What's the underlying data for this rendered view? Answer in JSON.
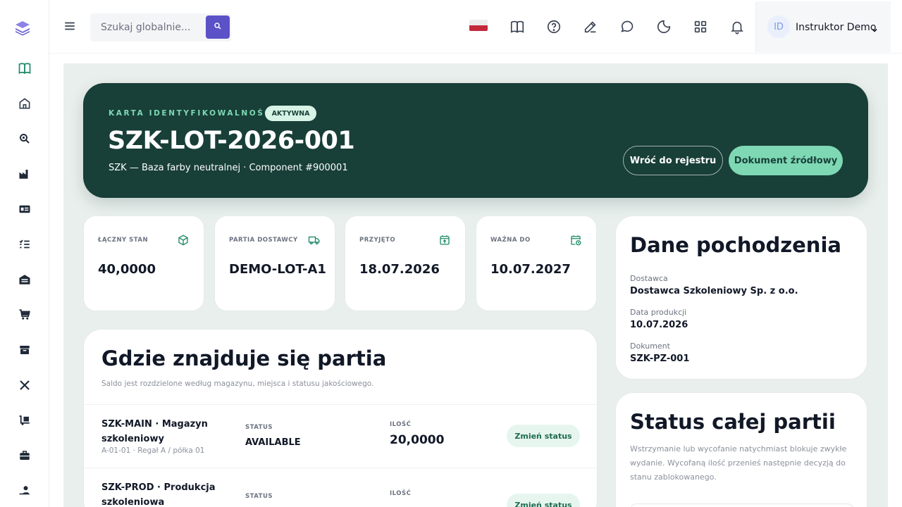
{
  "colors": {
    "accent": "#5b52c7",
    "hero_bg": "#183f38",
    "mint": "#7ed8b4",
    "panel_bg": "#e9efec"
  },
  "sidebar": {
    "items": [
      {
        "icon": "book-open-icon",
        "active": true
      },
      {
        "icon": "home-icon"
      },
      {
        "icon": "zoom-search-icon"
      },
      {
        "icon": "factory-icon"
      },
      {
        "icon": "id-card-icon"
      },
      {
        "icon": "checklist-icon"
      },
      {
        "icon": "warehouse-icon"
      },
      {
        "icon": "cart-icon"
      },
      {
        "icon": "box-icon"
      },
      {
        "icon": "tools-icon"
      },
      {
        "icon": "delivery-icon"
      },
      {
        "icon": "briefcase-icon"
      },
      {
        "icon": "hand-money-icon"
      }
    ]
  },
  "header": {
    "search_placeholder": "Szukaj globalnie...",
    "user_initials": "ID",
    "user_name": "Instruktor Demo"
  },
  "hero": {
    "kicker": "KARTA IDENTYFIKOWALNOŚCI",
    "badge": "AKTYWNA",
    "title": "SZK-LOT-2026-001",
    "subtitle": "SZK — Baza farby neutralnej · Component #900001",
    "back_label": "Wróć do rejestru",
    "doc_label": "Dokument źródłowy"
  },
  "stats": [
    {
      "label": "ŁĄCZNY STAN",
      "value": "40,0000",
      "icon": "cube-icon"
    },
    {
      "label": "PARTIA DOSTAWCY",
      "value": "DEMO-LOT-A1",
      "icon": "truck-icon"
    },
    {
      "label": "PRZYJĘTO",
      "value": "18.07.2026",
      "icon": "calendar-upload-icon"
    },
    {
      "label": "WAŻNA DO",
      "value": "10.07.2027",
      "icon": "calendar-clock-icon"
    }
  ],
  "locations": {
    "title": "Gdzie znajduje się partia",
    "subtitle": "Saldo jest rozdzielone według magazynu, miejsca i statusu jakościowego.",
    "status_label": "STATUS",
    "qty_label": "ILOŚĆ",
    "rows": [
      {
        "name": "SZK-MAIN · Magazyn szkoleniowy",
        "address": "A-01-01 · Regał A / półka 01",
        "status": "AVAILABLE",
        "qty": "20,0000",
        "action": "Zmień status"
      },
      {
        "name": "SZK-PROD · Produkcja szkoleniowa",
        "address": "",
        "status": "",
        "qty": "",
        "action": "Zmień status"
      }
    ]
  },
  "origin": {
    "title": "Dane pochodzenia",
    "fields": [
      {
        "label": "Dostawca",
        "value": "Dostawca Szkoleniowy Sp. z o.o."
      },
      {
        "label": "Data produkcji",
        "value": "10.07.2026"
      },
      {
        "label": "Dokument",
        "value": "SZK-PZ-001"
      }
    ]
  },
  "batch_status": {
    "title": "Status całej partii",
    "description": "Wstrzymanie lub wycofanie natychmiast blokuje zwykłe wydanie. Wycofaną ilość przenieś następnie decyzją do stanu zablokowanego."
  }
}
